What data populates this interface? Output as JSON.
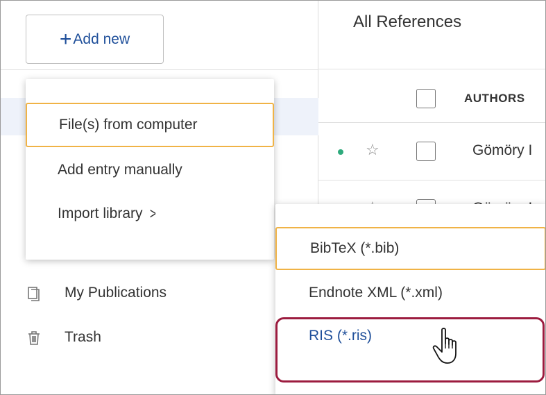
{
  "sidebar": {
    "add_new_label": "Add new",
    "items": [
      {
        "label": "My Publications",
        "icon": "publications-icon"
      },
      {
        "label": "Trash",
        "icon": "trash-icon"
      }
    ]
  },
  "main": {
    "title": "All References",
    "column_header": "AUTHORS",
    "rows": [
      {
        "author": "Gömöry I"
      },
      {
        "author": "Gömöry I"
      }
    ]
  },
  "add_menu": {
    "items": [
      {
        "label": "File(s) from computer"
      },
      {
        "label": "Add entry manually"
      },
      {
        "label": "Import library"
      }
    ]
  },
  "import_submenu": {
    "items": [
      {
        "label": "BibTeX (*.bib)"
      },
      {
        "label": "Endnote XML (*.xml)"
      },
      {
        "label": "RIS (*.ris)"
      }
    ]
  },
  "colors": {
    "accent_link": "#1f4f9a",
    "highlight_border": "#f0b346",
    "callout_border": "#9c1c3f",
    "status_dot": "#2eaa7c"
  }
}
